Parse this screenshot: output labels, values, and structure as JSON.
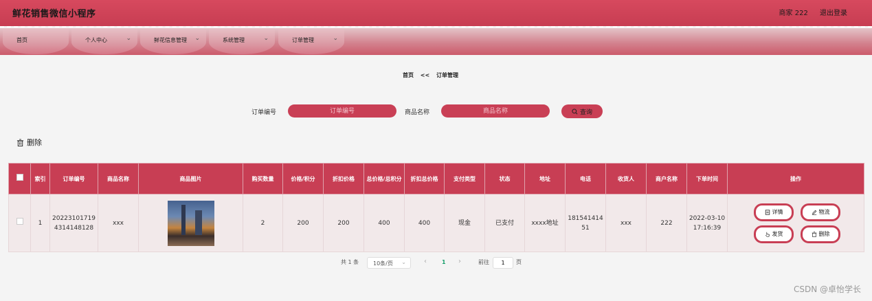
{
  "header": {
    "title": "鲜花销售微信小程序",
    "user": "商家 222",
    "logout": "退出登录"
  },
  "nav": [
    {
      "label": "首页",
      "chevron": ""
    },
    {
      "label": "个人中心",
      "chevron": "⌄"
    },
    {
      "label": "鲜花信息管理",
      "chevron": "⌄"
    },
    {
      "label": "系统管理",
      "chevron": "⌄"
    },
    {
      "label": "订单管理",
      "chevron": "⌄"
    }
  ],
  "breadcrumb": {
    "home": "首页",
    "sep": "<<",
    "current": "订单管理"
  },
  "search": {
    "order_label": "订单编号",
    "order_placeholder": "订单编号",
    "product_label": "商品名称",
    "product_placeholder": "商品名称",
    "button": "查询"
  },
  "bulk_delete": "删除",
  "table": {
    "headers": [
      "",
      "索引",
      "订单编号",
      "商品名称",
      "商品图片",
      "购买数量",
      "价格/积分",
      "折扣价格",
      "总价格/总积分",
      "折扣总价格",
      "支付类型",
      "状态",
      "地址",
      "电话",
      "收货人",
      "商户名称",
      "下单时间",
      "操作"
    ],
    "rows": [
      {
        "index": "1",
        "order_no": "202231017194314148128",
        "product": "xxx",
        "quantity": "2",
        "price": "200",
        "discount_price": "200",
        "total": "400",
        "discount_total": "400",
        "pay_type": "现金",
        "status": "已支付",
        "address": "xxxx地址",
        "phone": "18154141451",
        "receiver": "xxx",
        "merchant": "222",
        "order_time": "2022-03-10 17:16:39"
      }
    ],
    "actions": {
      "detail": "详情",
      "logistics": "物流",
      "ship": "发货",
      "delete": "删除"
    }
  },
  "pagination": {
    "total": "共 1 条",
    "page_size": "10条/页",
    "current_page": "1",
    "goto": "前往",
    "goto_value": "1",
    "page_unit": "页"
  },
  "watermark": "CSDN @卓怡学长",
  "colors": {
    "primary": "#c83e54",
    "nav": "#d67787",
    "active_page": "#1aa06d"
  }
}
